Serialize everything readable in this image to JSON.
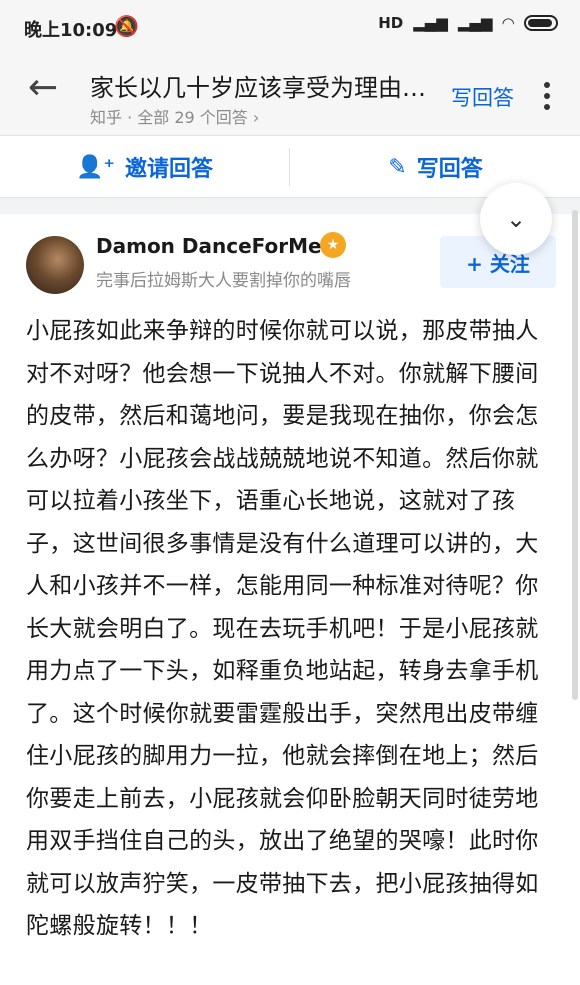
{
  "status_bar": {
    "time": "晚上10:09",
    "bell_icon": "bell-off-icon",
    "network": "HD"
  },
  "header": {
    "title": "家长以几十岁应该享受为理由…",
    "subtitle": "知乎 · 全部 29 个回答 ›",
    "write_answer": "写回答"
  },
  "actions": {
    "invite_label": "邀请回答",
    "write_label": "写回答"
  },
  "answer": {
    "author_name": "Damon DanceForMe",
    "author_bio": "完事后拉姆斯大人要割掉你的嘴唇",
    "follow_label": "+ 关注",
    "collapse_icon": "double-chevron-down-icon",
    "body": "小屁孩如此来争辩的时候你就可以说，那皮带抽人对不对呀？他会想一下说抽人不对。你就解下腰间的皮带，然后和蔼地问，要是我现在抽你，你会怎么办呀？小屁孩会战战兢兢地说不知道。然后你就可以拉着小孩坐下，语重心长地说，这就对了孩子，这世间很多事情是没有什么道理可以讲的，大人和小孩并不一样，怎能用同一种标准对待呢？你长大就会明白了。现在去玩手机吧！于是小屁孩就用力点了一下头，如释重负地站起，转身去拿手机了。这个时候你就要雷霆般出手，突然甩出皮带缠住小屁孩的脚用力一拉，他就会摔倒在地上；然后你要走上前去，小屁孩就会仰卧脸朝天同时徒劳地用双手挡住自己的头，放出了绝望的哭嚎！此时你就可以放声狞笑，一皮带抽下去，把小屁孩抽得如陀螺般旋转！！！"
  },
  "colors": {
    "accent": "#0a66d8",
    "follow_bg": "#ebf3ff"
  }
}
